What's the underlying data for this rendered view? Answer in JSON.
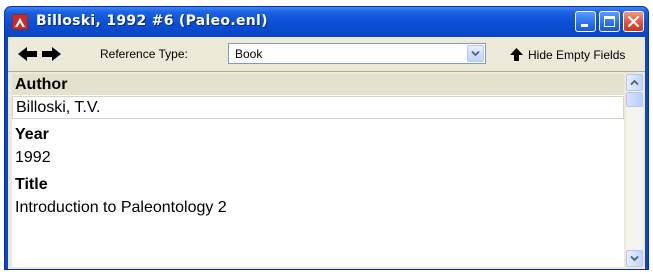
{
  "window": {
    "title": "Billoski, 1992 #6 (Paleo.enl)"
  },
  "toolbar": {
    "reference_type_label": "Reference Type:",
    "reference_type_value": "Book",
    "hide_empty_label": "Hide Empty Fields"
  },
  "fields": [
    {
      "label": "Author",
      "value": "Billoski, T.V."
    },
    {
      "label": "Year",
      "value": "1992"
    },
    {
      "label": "Title",
      "value": "Introduction to Paleontology 2"
    }
  ],
  "icons": {
    "app": "endnote-app-icon",
    "back": "back-arrow-icon",
    "forward": "forward-arrow-icon",
    "hide_empty": "up-arrow-icon",
    "minimize": "minimize-icon",
    "maximize": "maximize-icon",
    "close": "close-icon"
  }
}
